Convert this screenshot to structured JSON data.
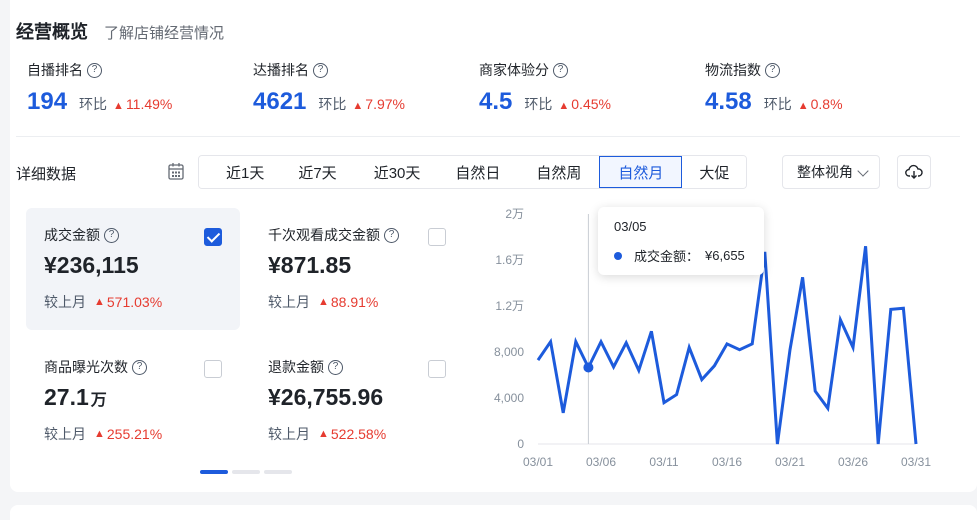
{
  "header": {
    "title": "经营概览",
    "subtitle": "了解店铺经营情况"
  },
  "metrics": [
    {
      "label": "自播排名",
      "value": "194",
      "cmp": "环比",
      "change": "11.49%"
    },
    {
      "label": "达播排名",
      "value": "4621",
      "cmp": "环比",
      "change": "7.97%"
    },
    {
      "label": "商家体验分",
      "value": "4.5",
      "cmp": "环比",
      "change": "0.45%"
    },
    {
      "label": "物流指数",
      "value": "4.58",
      "cmp": "环比",
      "change": "0.8%"
    }
  ],
  "detail": {
    "title": "详细数据",
    "tabs": [
      "近1天",
      "近7天",
      "近30天",
      "自然日",
      "自然周",
      "自然月",
      "大促"
    ],
    "active_tab": 5,
    "view_select": "整体视角"
  },
  "cards": [
    {
      "label": "成交金额",
      "value": "¥236,115",
      "unit": "",
      "cmp": "较上月",
      "change": "571.03%",
      "checked": true
    },
    {
      "label": "千次观看成交金额",
      "value": "¥871.85",
      "unit": "",
      "cmp": "较上月",
      "change": "88.91%",
      "checked": false
    },
    {
      "label": "商品曝光次数",
      "value": "27.1",
      "unit": "万",
      "cmp": "较上月",
      "change": "255.21%",
      "checked": false
    },
    {
      "label": "退款金额",
      "value": "¥26,755.96",
      "unit": "",
      "cmp": "较上月",
      "change": "522.58%",
      "checked": false
    }
  ],
  "tooltip": {
    "date": "03/05",
    "series": "成交金额：",
    "value": "¥6,655"
  },
  "chart_data": {
    "type": "line",
    "series": [
      {
        "name": "成交金额",
        "values": [
          7300,
          8900,
          2700,
          8900,
          6655,
          8900,
          6700,
          8800,
          6400,
          9800,
          3600,
          4300,
          8400,
          5600,
          6800,
          8700,
          8200,
          8700,
          16700,
          0,
          8200,
          14500,
          4600,
          3100,
          10800,
          8400,
          17200,
          0,
          11700,
          11800,
          0
        ]
      }
    ],
    "x": [
      "03/01",
      "03/02",
      "03/03",
      "03/04",
      "03/05",
      "03/06",
      "03/07",
      "03/08",
      "03/09",
      "03/10",
      "03/11",
      "03/12",
      "03/13",
      "03/14",
      "03/15",
      "03/16",
      "03/17",
      "03/18",
      "03/19",
      "03/20",
      "03/21",
      "03/22",
      "03/23",
      "03/24",
      "03/25",
      "03/26",
      "03/27",
      "03/28",
      "03/29",
      "03/30",
      "03/31"
    ],
    "xticks": [
      "03/01",
      "03/06",
      "03/11",
      "03/16",
      "03/21",
      "03/26",
      "03/31"
    ],
    "yticks": [
      "0",
      "4,000",
      "8,000",
      "1.2万",
      "1.6万",
      "2万"
    ],
    "ylim": [
      0,
      20000
    ],
    "highlight_index": 4,
    "color": "#1d5bdc",
    "grid": false
  }
}
